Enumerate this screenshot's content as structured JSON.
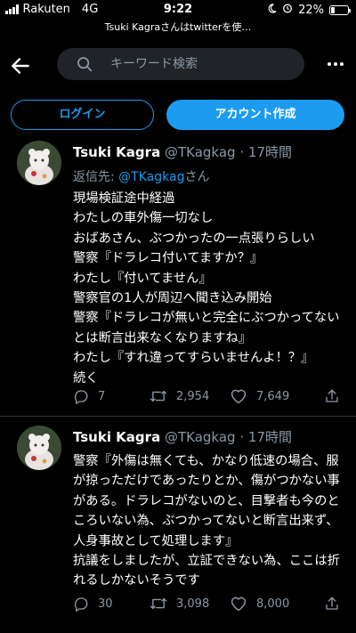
{
  "status_bar": {
    "carrier": "Rakuten",
    "network": "4G",
    "time": "9:22",
    "battery": "22%",
    "battery_level": 0.22
  },
  "url_bar": {
    "title": "Tsuki Kagraさんはtwitterを使…"
  },
  "topbar": {
    "search_placeholder": "キーワード検索",
    "icons": [
      "back-arrow-icon",
      "search-icon",
      "more-icon"
    ]
  },
  "auth": {
    "login_label": "ログイン",
    "signup_label": "アカウント作成"
  },
  "tweets": [
    {
      "name": "Tsuki Kagra",
      "handle": "@TKagkag",
      "separator": "·",
      "time": "17時間",
      "reply_prefix": "返信先: ",
      "reply_to": "@TKagkag",
      "reply_suffix": "さん",
      "text": "現場検証途中経過\nわたしの車外傷一切なし\nおばあさん、ぶつかったの一点張りらしい\n警察『ドラレコ付いてますか？』\nわたし『付いてません』\n警察官の1人が周辺へ聞き込み開始\n警察『ドラレコが無いと完全にぶつかってないとは断言出来なくなりますね』\nわたし『すれ違ってすらいませんよ！？』\n続く",
      "replies": "7",
      "retweets": "2,954",
      "likes": "7,649"
    },
    {
      "name": "Tsuki Kagra",
      "handle": "@TKagkag",
      "separator": "·",
      "time": "17時間",
      "text": "警察『外傷は無くても、かなり低速の場合、服が掠っただけであったりとか、傷がつかない事がある。ドラレコがないのと、目撃者も今のところいない為、ぶつかってないと断言出来ず、人身事故として処理します』\n抗議をしましたが、立証できない為、ここは折れるしかないそうです",
      "replies": "30",
      "retweets": "3,098",
      "likes": "8,000"
    }
  ],
  "colors": {
    "accent": "#1d9bf0",
    "background": "#000000",
    "muted": "#8b98a5"
  }
}
